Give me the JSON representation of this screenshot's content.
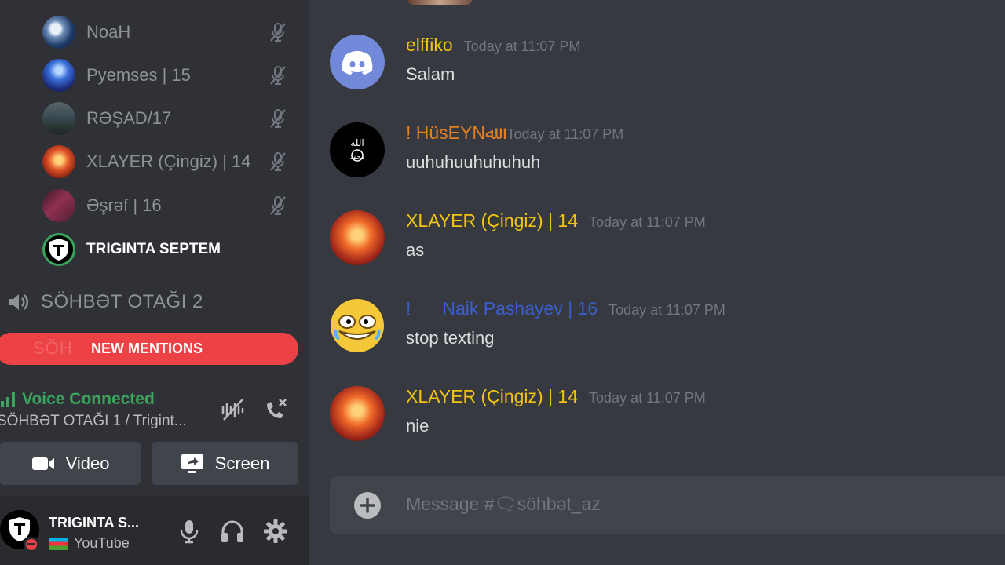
{
  "sidebar": {
    "voice_members": [
      {
        "name": "NoaH",
        "avatar_icon": "wave-painting-avatar",
        "muted": true
      },
      {
        "name": "Pyemses | 15",
        "avatar_icon": "blue-glow-avatar",
        "muted": true
      },
      {
        "name": "RƏŞAD/17",
        "avatar_icon": "landscape-avatar",
        "muted": true
      },
      {
        "name": "XLAYER (Çingiz) | 14",
        "avatar_icon": "fire-avatar",
        "muted": true
      },
      {
        "name": "Əşrəf | 16",
        "avatar_icon": "pink-avatar",
        "muted": true
      },
      {
        "name": "TRIGINTA SEPTEM",
        "avatar_icon": "shield-t-avatar",
        "muted": false,
        "speaking": true
      }
    ],
    "voice_channel": {
      "name": "SÖHBƏT OTAĞI 2",
      "icon": "speaker-icon"
    },
    "new_mentions": {
      "label": "NEW MENTIONS",
      "ghost_text": "SÖH"
    },
    "voice_connection": {
      "status": "Voice Connected",
      "channel": "SÖHBƏT OTAĞI 1 / Trigint...",
      "video_label": "Video",
      "screen_label": "Screen"
    },
    "user": {
      "name": "TRIGINTA S...",
      "status_text": "YouTube",
      "flag": "azerbaijan-flag"
    }
  },
  "chat": {
    "messages": [
      {
        "author": "elffiko",
        "author_color": "#f1c40f",
        "time": "Today at 11:07 PM",
        "text": "Salam",
        "avatar": "discord-logo-avatar"
      },
      {
        "author": "! HüsEYNﷲ",
        "author_color": "#e67e22",
        "time": "Today at 11:07 PM",
        "text": "uuhuhuuhuhuhuh",
        "avatar": "calligraphy-avatar"
      },
      {
        "author": "XLAYER (Çingiz) | 14",
        "author_color": "#f1c40f",
        "time": "Today at 11:07 PM",
        "text": "as",
        "avatar": "fire-avatar"
      },
      {
        "author_prefix": "!",
        "author": "Naik Pashayev | 16",
        "author_color": "#3b5ecf",
        "time": "Today at 11:07 PM",
        "text": "stop texting",
        "avatar": "laughing-face-avatar"
      },
      {
        "author": "XLAYER (Çingiz) | 14",
        "author_color": "#f1c40f",
        "time": "Today at 11:07 PM",
        "text": "nie",
        "avatar": "fire-avatar"
      }
    ],
    "composer": {
      "placeholder": "Message #🗨söhbət_az"
    }
  },
  "colors": {
    "sidebar_bg": "#2f3136",
    "chat_bg": "#36393f",
    "userbar_bg": "#292b2f",
    "mentions_red": "#ed4245",
    "connected_green": "#3ba55d",
    "muted_text": "#8e9297",
    "timestamp": "#72767d"
  }
}
